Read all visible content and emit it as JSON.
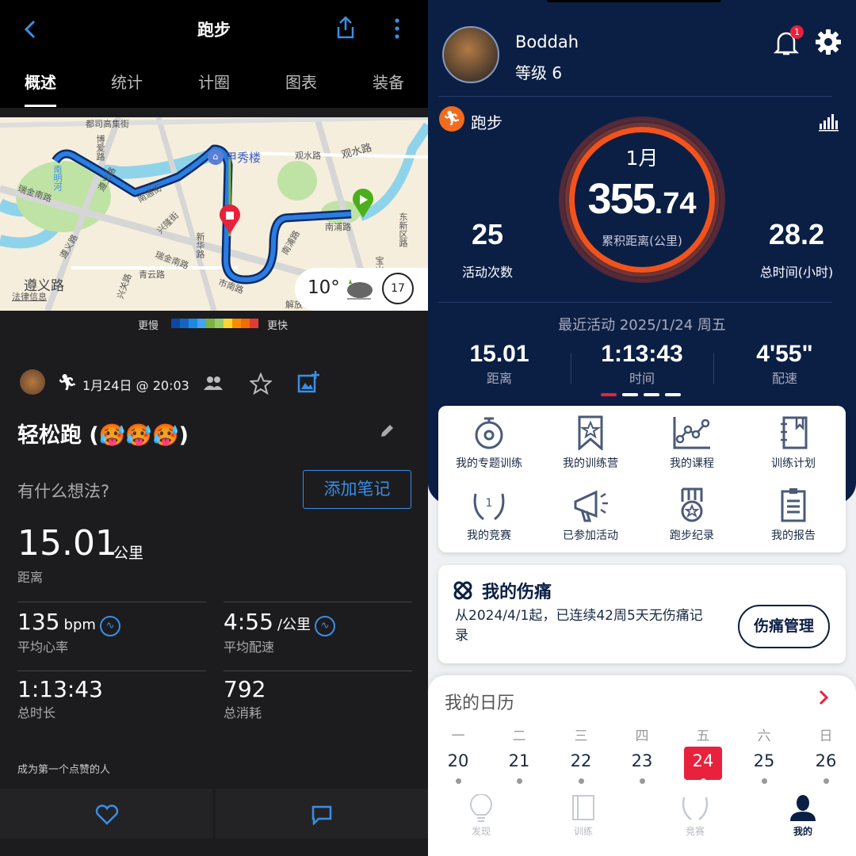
{
  "left": {
    "header": {
      "title": "跑步",
      "back_icon": "chevron-left-icon",
      "share_icon": "share-icon",
      "more_icon": "more-vertical-icon"
    },
    "tabs": [
      {
        "label": "概述",
        "active": true
      },
      {
        "label": "统计"
      },
      {
        "label": "计圈"
      },
      {
        "label": "图表"
      },
      {
        "label": "装备"
      }
    ],
    "map": {
      "labels": [
        "都司高集街",
        "博爱路",
        "瑞金南路",
        "南明河",
        "遵义路",
        "甲秀楼",
        "观水路",
        "观水路",
        "南浦路",
        "南浦路",
        "东新区路",
        "新华路",
        "瑞金南路",
        "青云路",
        "兴隆街",
        "南通街",
        "市南路",
        "遵义路",
        "法律信息",
        "遵义路",
        "兴关路",
        "解放",
        "宝山"
      ],
      "landmark": "甲秀楼",
      "weather": {
        "temp": "10°",
        "icon": "cloudy-icon",
        "wind": "17"
      }
    },
    "legend": {
      "slow": "更慢",
      "fast": "更快",
      "colors": [
        "#0d47a1",
        "#1565c0",
        "#1e88e5",
        "#42a5f5",
        "#7cb342",
        "#9ccc65",
        "#fdd835",
        "#fb8c00",
        "#ef6c00",
        "#e53935"
      ]
    },
    "activity": {
      "datetime": "1月24日 @ 20:03",
      "title": "轻松跑 (🥵🥵🥵)",
      "note_prompt": "有什么想法?",
      "add_note": "添加笔记"
    },
    "distance": {
      "value": "15.01",
      "unit": "公里",
      "label": "距离"
    },
    "stats": [
      {
        "value": "135",
        "unit": "bpm",
        "label": "平均心率"
      },
      {
        "value": "4:55",
        "unit": "/公里",
        "label": "平均配速"
      },
      {
        "value": "1:13:43",
        "unit": "",
        "label": "总时长"
      },
      {
        "value": "792",
        "unit": "",
        "label": "总消耗"
      }
    ],
    "like_prompt": "成为第一个点赞的人",
    "accent": "#3a8ee6"
  },
  "right": {
    "user": {
      "name": "Boddah",
      "level": "等级 6",
      "notification_count": "1"
    },
    "sport": "跑步",
    "ring": {
      "month": "1月",
      "distance_int": "355",
      "distance_dec": ".74",
      "label": "累积距离(公里)"
    },
    "activities": {
      "value": "25",
      "label": "活动次数"
    },
    "time": {
      "value": "28.2",
      "label": "总时间(小时)"
    },
    "recent": {
      "title": "最近活动 2025/1/24 周五",
      "items": [
        {
          "value": "15.01",
          "label": "距离"
        },
        {
          "value": "1:13:43",
          "label": "时间"
        },
        {
          "value": "4'55\"",
          "label": "配速"
        }
      ],
      "page_index": 1,
      "page_count": 4
    },
    "grid": [
      {
        "label": "我的专题训练",
        "icon": "stopwatch-icon"
      },
      {
        "label": "我的训练营",
        "icon": "bookmark-star-icon"
      },
      {
        "label": "我的课程",
        "icon": "line-chart-icon"
      },
      {
        "label": "训练计划",
        "icon": "notebook-icon"
      },
      {
        "label": "我的竞赛",
        "icon": "laurel-icon"
      },
      {
        "label": "已参加活动",
        "icon": "megaphone-icon"
      },
      {
        "label": "跑步纪录",
        "icon": "medal-icon"
      },
      {
        "label": "我的报告",
        "icon": "clipboard-icon"
      }
    ],
    "injury": {
      "title": "我的伤痛",
      "text": "从2024/4/1起，已连续42周5天无伤痛记录",
      "button": "伤痛管理"
    },
    "calendar": {
      "title": "我的日历",
      "weekdays": [
        "一",
        "二",
        "三",
        "四",
        "五",
        "六",
        "日"
      ],
      "days": [
        "20",
        "21",
        "22",
        "23",
        "24",
        "25",
        "26"
      ],
      "selected": "24"
    },
    "nav": [
      {
        "label": "发现"
      },
      {
        "label": "训练"
      },
      {
        "label": "竞赛"
      },
      {
        "label": "我的",
        "active": true
      }
    ],
    "colors": {
      "navy": "#0b1f45",
      "accent_red": "#e8223c",
      "orange": "#f26b1d"
    }
  }
}
